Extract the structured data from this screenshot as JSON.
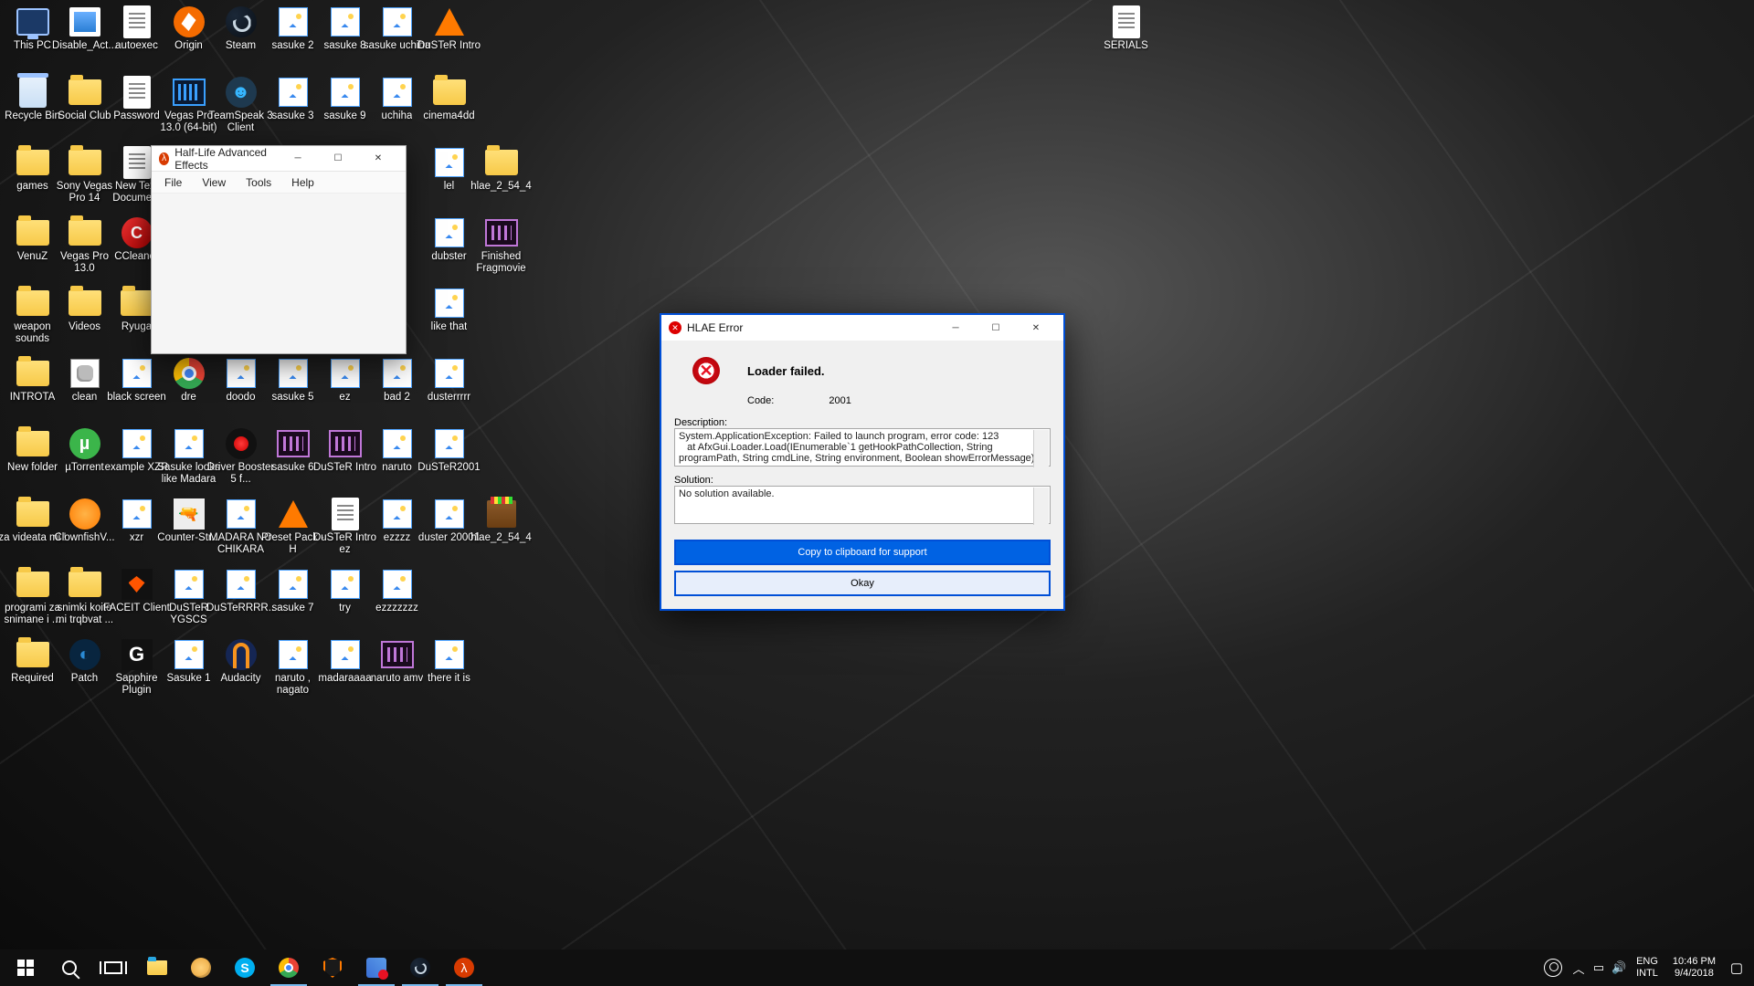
{
  "desktop_icons": [
    {
      "col": 0,
      "row": 0,
      "icon": "ic-pc",
      "label": "This PC",
      "name": "thispc-icon"
    },
    {
      "col": 1,
      "row": 0,
      "icon": "ic-disable",
      "label": "Disable_Act...",
      "name": "disableact-icon"
    },
    {
      "col": 2,
      "row": 0,
      "icon": "ic-textdoc",
      "label": "autoexec",
      "name": "autoexec-icon"
    },
    {
      "col": 3,
      "row": 0,
      "icon": "ic-origin",
      "label": "Origin",
      "name": "origin-icon"
    },
    {
      "col": 4,
      "row": 0,
      "icon": "ic-steam",
      "label": "Steam",
      "name": "steam-icon"
    },
    {
      "col": 5,
      "row": 0,
      "icon": "ic-image",
      "label": "sasuke 2",
      "name": "sasuke2-icon"
    },
    {
      "col": 6,
      "row": 0,
      "icon": "ic-image",
      "label": "sasuke 8",
      "name": "sasuke8-icon"
    },
    {
      "col": 7,
      "row": 0,
      "icon": "ic-image",
      "label": "sasuke uchiha",
      "name": "sasukeuchiha-icon"
    },
    {
      "col": 8,
      "row": 0,
      "icon": "ic-vlc",
      "label": "DuSTeR Intro",
      "name": "dusterintro-icon"
    },
    {
      "col": 21,
      "row": 0,
      "icon": "ic-textdoc",
      "label": "SERIALS",
      "name": "serials-icon"
    },
    {
      "col": 0,
      "row": 1,
      "icon": "ic-bin",
      "label": "Recycle Bin",
      "name": "recyclebin-icon"
    },
    {
      "col": 1,
      "row": 1,
      "icon": "ic-folder",
      "label": "Social Club",
      "name": "socialclub-icon"
    },
    {
      "col": 2,
      "row": 1,
      "icon": "ic-textdoc",
      "label": "Password",
      "name": "password-icon"
    },
    {
      "col": 3,
      "row": 1,
      "icon": "ic-vegas",
      "label": "Vegas Pro 13.0 (64-bit)",
      "name": "vegas13-64-icon"
    },
    {
      "col": 4,
      "row": 1,
      "icon": "ic-ts",
      "label": "TeamSpeak 3 Client",
      "name": "teamspeak-icon",
      "glyph": "☻"
    },
    {
      "col": 5,
      "row": 1,
      "icon": "ic-image",
      "label": "sasuke 3",
      "name": "sasuke3-icon"
    },
    {
      "col": 6,
      "row": 1,
      "icon": "ic-image",
      "label": "sasuke 9",
      "name": "sasuke9-icon"
    },
    {
      "col": 7,
      "row": 1,
      "icon": "ic-image",
      "label": "uchiha",
      "name": "uchiha-icon"
    },
    {
      "col": 8,
      "row": 1,
      "icon": "ic-folder",
      "label": "cinema4dd",
      "name": "cinema4dd-icon"
    },
    {
      "col": 0,
      "row": 2,
      "icon": "ic-folder",
      "label": "games",
      "name": "games-icon"
    },
    {
      "col": 1,
      "row": 2,
      "icon": "ic-folder",
      "label": "Sony Vegas Pro 14",
      "name": "svpro14-icon"
    },
    {
      "col": 2,
      "row": 2,
      "icon": "ic-textdoc",
      "label": "New Text Document",
      "name": "newtext-icon"
    },
    {
      "col": 8,
      "row": 2,
      "icon": "ic-image",
      "label": "lel",
      "name": "lel-icon"
    },
    {
      "col": 9,
      "row": 2,
      "icon": "ic-folder",
      "label": "hlae_2_54_4",
      "name": "hlaefolder-icon"
    },
    {
      "col": 0,
      "row": 3,
      "icon": "ic-folder",
      "label": "VenuZ",
      "name": "venuz-icon"
    },
    {
      "col": 1,
      "row": 3,
      "icon": "ic-folder",
      "label": "Vegas Pro 13.0",
      "name": "vegas13-icon"
    },
    {
      "col": 2,
      "row": 3,
      "icon": "ic-ccleaner",
      "label": "CCleaner",
      "name": "ccleaner-icon"
    },
    {
      "col": 8,
      "row": 3,
      "icon": "ic-image",
      "label": "dubster",
      "name": "dubster-icon"
    },
    {
      "col": 9,
      "row": 3,
      "icon": "ic-premiere",
      "label": "Finished Fragmovie",
      "name": "finishedfrag-icon"
    },
    {
      "col": 0,
      "row": 4,
      "icon": "ic-folder",
      "label": "weapon sounds",
      "name": "weaponsounds-icon"
    },
    {
      "col": 1,
      "row": 4,
      "icon": "ic-folder",
      "label": "Videos",
      "name": "videos-icon"
    },
    {
      "col": 2,
      "row": 4,
      "icon": "ic-folder",
      "label": "Ryuga",
      "name": "ryuga-icon"
    },
    {
      "col": 8,
      "row": 4,
      "icon": "ic-image",
      "label": "like that",
      "name": "likethat-icon"
    },
    {
      "col": 0,
      "row": 5,
      "icon": "ic-folder",
      "label": "INTROTA",
      "name": "introta-icon"
    },
    {
      "col": 1,
      "row": 5,
      "icon": "ic-batch",
      "label": "clean",
      "name": "clean-icon"
    },
    {
      "col": 2,
      "row": 5,
      "icon": "ic-image",
      "label": "black screen",
      "name": "blackscreen-icon"
    },
    {
      "col": 3,
      "row": 5,
      "icon": "ic-chrome",
      "label": "dre",
      "name": "dre-icon"
    },
    {
      "col": 4,
      "row": 5,
      "icon": "ic-image",
      "label": "doodo",
      "name": "doodo-icon"
    },
    {
      "col": 5,
      "row": 5,
      "icon": "ic-image",
      "label": "sasuke 5",
      "name": "sasuke5-icon"
    },
    {
      "col": 6,
      "row": 5,
      "icon": "ic-image",
      "label": "ez",
      "name": "ez-icon"
    },
    {
      "col": 7,
      "row": 5,
      "icon": "ic-image",
      "label": "bad 2",
      "name": "bad2-icon"
    },
    {
      "col": 8,
      "row": 5,
      "icon": "ic-image",
      "label": "dusterrrrr",
      "name": "dusterrrrr-icon"
    },
    {
      "col": 0,
      "row": 6,
      "icon": "ic-folder",
      "label": "New folder",
      "name": "newfolder-icon"
    },
    {
      "col": 1,
      "row": 6,
      "icon": "ic-utorrent",
      "label": "µTorrent",
      "name": "utorrent-icon",
      "glyph": "µ"
    },
    {
      "col": 2,
      "row": 6,
      "icon": "ic-image",
      "label": "example XZR",
      "name": "examplexzr-icon"
    },
    {
      "col": 3,
      "row": 6,
      "icon": "ic-image",
      "label": "Sasuke looks like Madara",
      "name": "sasukemad-icon"
    },
    {
      "col": 4,
      "row": 6,
      "icon": "ic-driver",
      "label": "Driver Booster 5 f...",
      "name": "driverbooster-icon"
    },
    {
      "col": 5,
      "row": 6,
      "icon": "ic-premiere",
      "label": "sasuke 6",
      "name": "sasuke6-icon"
    },
    {
      "col": 6,
      "row": 6,
      "icon": "ic-premiere",
      "label": "DuSTeR Intro",
      "name": "dusterintro2-icon"
    },
    {
      "col": 7,
      "row": 6,
      "icon": "ic-image",
      "label": "naruto",
      "name": "naruto-icon"
    },
    {
      "col": 8,
      "row": 6,
      "icon": "ic-image",
      "label": "DuSTeR2001",
      "name": "duster2001img-icon"
    },
    {
      "col": 0,
      "row": 7,
      "icon": "ic-folder",
      "label": "za videata mi !",
      "name": "zavideata-icon"
    },
    {
      "col": 1,
      "row": 7,
      "icon": "ic-clownfish",
      "label": "ClownfishV...",
      "name": "clownfish-icon"
    },
    {
      "col": 2,
      "row": 7,
      "icon": "ic-image",
      "label": "xzr",
      "name": "xzr-icon"
    },
    {
      "col": 3,
      "row": 7,
      "icon": "ic-cs",
      "label": "Counter-Str...",
      "name": "cs-icon",
      "glyph": "🔫"
    },
    {
      "col": 4,
      "row": 7,
      "icon": "ic-image",
      "label": "MADARA NO CHIKARA",
      "name": "madara-icon"
    },
    {
      "col": 5,
      "row": 7,
      "icon": "ic-vlc",
      "label": "Preset Pack - H",
      "name": "presetpack-icon"
    },
    {
      "col": 6,
      "row": 7,
      "icon": "ic-textdoc",
      "label": "DuSTeR Intro ez",
      "name": "dusterintroez-icon"
    },
    {
      "col": 7,
      "row": 7,
      "icon": "ic-image",
      "label": "ezzzz",
      "name": "ezzzz-icon"
    },
    {
      "col": 8,
      "row": 7,
      "icon": "ic-image",
      "label": "duster 20001",
      "name": "duster20001-icon"
    },
    {
      "col": 9,
      "row": 7,
      "icon": "ic-winrar",
      "label": "hlae_2_54_4",
      "name": "hlaerar-icon"
    },
    {
      "col": 0,
      "row": 8,
      "icon": "ic-folder",
      "label": "programi za snimane i ...",
      "name": "programi-icon"
    },
    {
      "col": 1,
      "row": 8,
      "icon": "ic-folder",
      "label": "snimki koito mi trqbvat ...",
      "name": "snimki-icon"
    },
    {
      "col": 2,
      "row": 8,
      "icon": "ic-faceit",
      "label": "FACEIT Client",
      "name": "faceit-icon"
    },
    {
      "col": 3,
      "row": 8,
      "icon": "ic-image",
      "label": "DuSTeR YGSCS",
      "name": "dusterygscs-icon"
    },
    {
      "col": 4,
      "row": 8,
      "icon": "ic-image",
      "label": "DuSTeRRRR...",
      "name": "dusterrrr2-icon"
    },
    {
      "col": 5,
      "row": 8,
      "icon": "ic-image",
      "label": "sasuke 7",
      "name": "sasuke7-icon"
    },
    {
      "col": 6,
      "row": 8,
      "icon": "ic-image",
      "label": "try",
      "name": "try-icon"
    },
    {
      "col": 7,
      "row": 8,
      "icon": "ic-image",
      "label": "ezzzzzzz",
      "name": "ezzzzzzz-icon"
    },
    {
      "col": 0,
      "row": 9,
      "icon": "ic-folder",
      "label": "Required",
      "name": "required-icon"
    },
    {
      "col": 1,
      "row": 9,
      "icon": "ic-patch",
      "label": "Patch",
      "name": "patch-icon",
      "glyph": "◐"
    },
    {
      "col": 2,
      "row": 9,
      "icon": "ic-sapphire",
      "label": "Sapphire Plugin",
      "name": "sapphire-icon",
      "glyph": "G"
    },
    {
      "col": 3,
      "row": 9,
      "icon": "ic-image",
      "label": "Sasuke 1",
      "name": "sasuke1-icon"
    },
    {
      "col": 4,
      "row": 9,
      "icon": "ic-audacity",
      "label": "Audacity",
      "name": "audacity-icon"
    },
    {
      "col": 5,
      "row": 9,
      "icon": "ic-image",
      "label": "naruto , nagato",
      "name": "narutonag-icon"
    },
    {
      "col": 6,
      "row": 9,
      "icon": "ic-image",
      "label": "madaraaaa",
      "name": "madaraaaa-icon"
    },
    {
      "col": 7,
      "row": 9,
      "icon": "ic-premiere",
      "label": "naruto amv",
      "name": "narutoamv-icon"
    },
    {
      "col": 8,
      "row": 9,
      "icon": "ic-image",
      "label": "there it is",
      "name": "thereitis-icon"
    }
  ],
  "hlae_window": {
    "title": "Half-Life Advanced Effects",
    "menus": [
      "File",
      "View",
      "Tools",
      "Help"
    ]
  },
  "error_dialog": {
    "title": "HLAE Error",
    "header": "Loader failed.",
    "code_label": "Code:",
    "code_value": "2001",
    "desc_label": "Description:",
    "desc_text": "System.ApplicationException: Failed to launch program, error code: 123\n   at AfxGui.Loader.Load(IEnumerable`1 getHookPathCollection, String programPath, String cmdLine, String environment, Boolean showErrorMessage)",
    "sol_label": "Solution:",
    "sol_text": "No solution available.",
    "btn_copy": "Copy to clipboard for support",
    "btn_ok": "Okay"
  },
  "taskbar": {
    "lang1": "ENG",
    "lang2": "INTL",
    "time": "10:46 PM",
    "date": "9/4/2018"
  }
}
